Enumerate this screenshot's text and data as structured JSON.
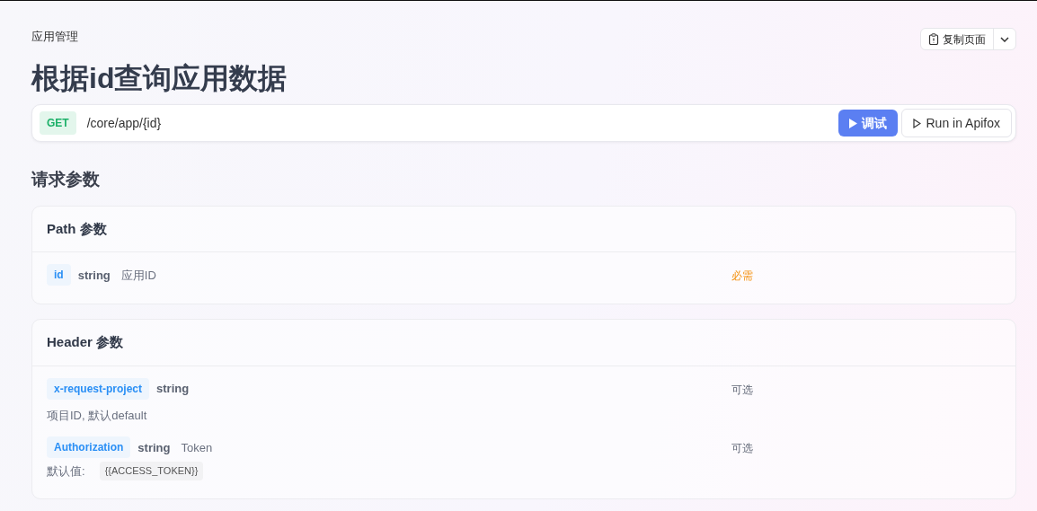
{
  "breadcrumb": "应用管理",
  "copy_button": {
    "label": "复制页面"
  },
  "title": "根据id查询应用数据",
  "endpoint": {
    "method": "GET",
    "path": "/core/app/{id}"
  },
  "actions": [
    {
      "kind": "primary",
      "label": "调试"
    },
    {
      "kind": "outline",
      "label": "Run in Apifox"
    }
  ],
  "section_title": "请求参数",
  "groups": [
    {
      "title": "Path 参数",
      "params": [
        {
          "name": "id",
          "type": "string",
          "description": "应用ID",
          "requirement": "必需",
          "required": true
        }
      ]
    },
    {
      "title": "Header 参数",
      "params": [
        {
          "name": "x-request-project",
          "type": "string",
          "note": "项目ID, 默认default",
          "requirement": "可选",
          "required": false
        },
        {
          "name": "Authorization",
          "type": "string",
          "description": "Token",
          "default_label": "默认值:",
          "default_value": "{{ACCESS_TOKEN}}",
          "requirement": "可选",
          "required": false
        }
      ]
    }
  ]
}
